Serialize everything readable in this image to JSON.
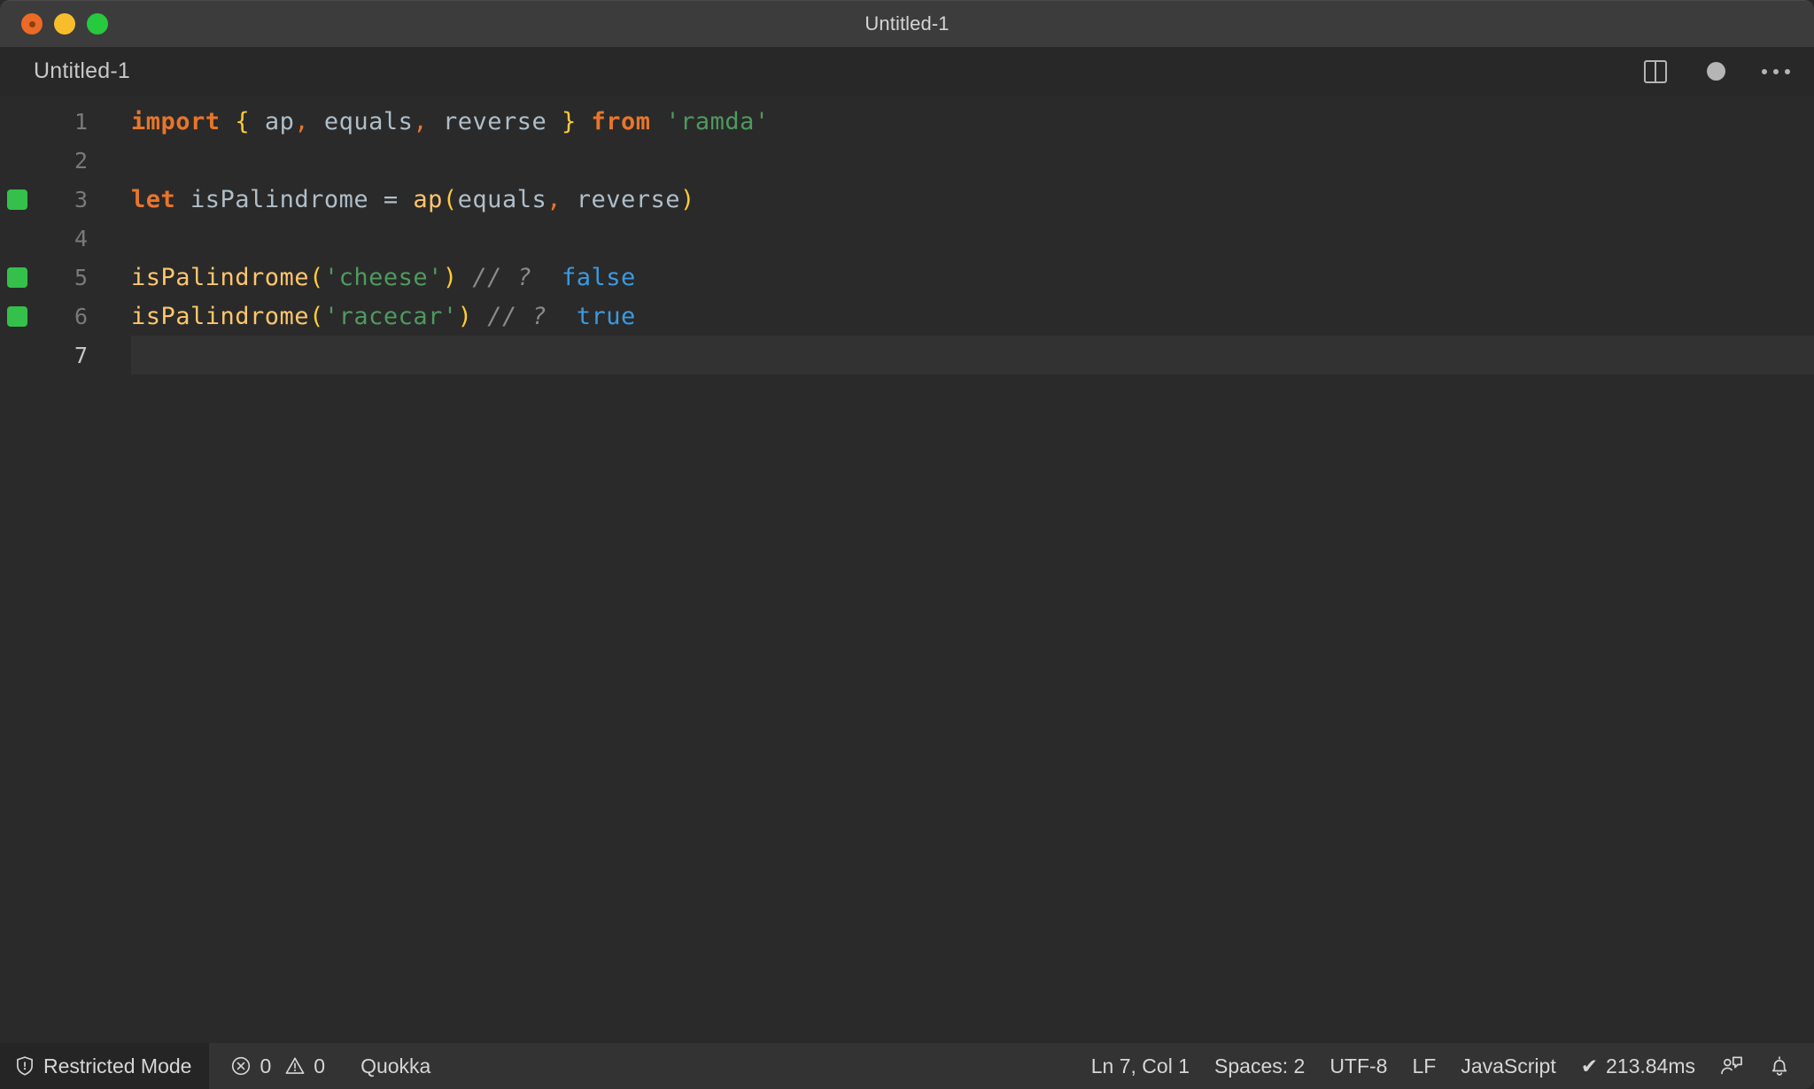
{
  "window": {
    "title": "Untitled-1",
    "traffic_lights": [
      "close-button",
      "minimize-button",
      "maximize-button"
    ]
  },
  "tabstrip": {
    "label": "Untitled-1",
    "actions": [
      "split-editor-icon",
      "unsaved-dot-icon",
      "more-actions-icon"
    ]
  },
  "editor": {
    "language": "JavaScript",
    "lines": [
      {
        "number": "1",
        "marker": false,
        "active": false,
        "tokens": [
          {
            "t": "import",
            "c": "t-kw"
          },
          {
            "t": " ",
            "c": "t-plain"
          },
          {
            "t": "{",
            "c": "t-brace1"
          },
          {
            "t": " ap",
            "c": "t-var"
          },
          {
            "t": ",",
            "c": "t-punc"
          },
          {
            "t": " equals",
            "c": "t-var"
          },
          {
            "t": ",",
            "c": "t-punc"
          },
          {
            "t": " reverse ",
            "c": "t-var"
          },
          {
            "t": "}",
            "c": "t-brace1"
          },
          {
            "t": " ",
            "c": "t-plain"
          },
          {
            "t": "from",
            "c": "t-kw"
          },
          {
            "t": " ",
            "c": "t-plain"
          },
          {
            "t": "'ramda'",
            "c": "t-str"
          }
        ]
      },
      {
        "number": "2",
        "marker": false,
        "active": false,
        "tokens": []
      },
      {
        "number": "3",
        "marker": true,
        "active": false,
        "tokens": [
          {
            "t": "let",
            "c": "t-kw"
          },
          {
            "t": " isPalindrome ",
            "c": "t-var"
          },
          {
            "t": "=",
            "c": "t-op"
          },
          {
            "t": " ",
            "c": "t-plain"
          },
          {
            "t": "ap",
            "c": "t-fn"
          },
          {
            "t": "(",
            "c": "t-brace1"
          },
          {
            "t": "equals",
            "c": "t-var"
          },
          {
            "t": ",",
            "c": "t-punc"
          },
          {
            "t": " reverse",
            "c": "t-var"
          },
          {
            "t": ")",
            "c": "t-brace1"
          }
        ]
      },
      {
        "number": "4",
        "marker": false,
        "active": false,
        "tokens": []
      },
      {
        "number": "5",
        "marker": true,
        "active": false,
        "tokens": [
          {
            "t": "isPalindrome",
            "c": "t-fn"
          },
          {
            "t": "(",
            "c": "t-brace1"
          },
          {
            "t": "'cheese'",
            "c": "t-str"
          },
          {
            "t": ")",
            "c": "t-brace1"
          },
          {
            "t": " ",
            "c": "t-plain"
          },
          {
            "t": "// ?",
            "c": "t-comment"
          },
          {
            "t": "  ",
            "c": "t-plain"
          },
          {
            "t": "false",
            "c": "t-bool"
          }
        ]
      },
      {
        "number": "6",
        "marker": true,
        "active": false,
        "tokens": [
          {
            "t": "isPalindrome",
            "c": "t-fn"
          },
          {
            "t": "(",
            "c": "t-brace1"
          },
          {
            "t": "'racecar'",
            "c": "t-str"
          },
          {
            "t": ")",
            "c": "t-brace1"
          },
          {
            "t": " ",
            "c": "t-plain"
          },
          {
            "t": "// ?",
            "c": "t-comment"
          },
          {
            "t": "  ",
            "c": "t-plain"
          },
          {
            "t": "true",
            "c": "t-bool"
          }
        ]
      },
      {
        "number": "7",
        "marker": false,
        "active": true,
        "tokens": []
      }
    ]
  },
  "statusbar": {
    "restricted_mode": "Restricted Mode",
    "errors": "0",
    "warnings": "0",
    "quokka": "Quokka",
    "cursor_position": "Ln 7, Col 1",
    "indentation": "Spaces: 2",
    "encoding": "UTF-8",
    "eol": "LF",
    "language": "JavaScript",
    "run_time": "213.84ms",
    "run_time_check": "✔",
    "icons": [
      "shield-icon",
      "error-icon",
      "warning-icon",
      "feedback-icon",
      "bell-icon"
    ]
  },
  "colors": {
    "titlebar_bg": "#3c3c3c",
    "editor_bg": "#2a2a2a",
    "statusbar_bg": "#333333",
    "marker_green": "#34c04a",
    "keyword_orange": "#e8752b",
    "string_green": "#4e9a5f",
    "bracket_yellow": "#ffcb39",
    "function_amber": "#ffc66d",
    "bool_blue": "#3b9ae0"
  }
}
